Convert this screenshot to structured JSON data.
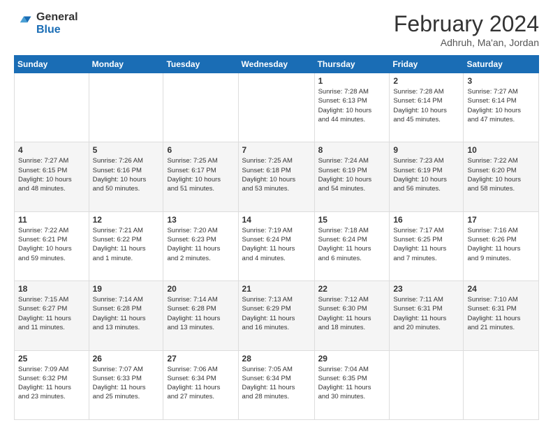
{
  "logo": {
    "general": "General",
    "blue": "Blue"
  },
  "title": "February 2024",
  "subtitle": "Adhruh, Ma'an, Jordan",
  "days_of_week": [
    "Sunday",
    "Monday",
    "Tuesday",
    "Wednesday",
    "Thursday",
    "Friday",
    "Saturday"
  ],
  "weeks": [
    [
      {
        "day": "",
        "info": ""
      },
      {
        "day": "",
        "info": ""
      },
      {
        "day": "",
        "info": ""
      },
      {
        "day": "",
        "info": ""
      },
      {
        "day": "1",
        "info": "Sunrise: 7:28 AM\nSunset: 6:13 PM\nDaylight: 10 hours\nand 44 minutes."
      },
      {
        "day": "2",
        "info": "Sunrise: 7:28 AM\nSunset: 6:14 PM\nDaylight: 10 hours\nand 45 minutes."
      },
      {
        "day": "3",
        "info": "Sunrise: 7:27 AM\nSunset: 6:14 PM\nDaylight: 10 hours\nand 47 minutes."
      }
    ],
    [
      {
        "day": "4",
        "info": "Sunrise: 7:27 AM\nSunset: 6:15 PM\nDaylight: 10 hours\nand 48 minutes."
      },
      {
        "day": "5",
        "info": "Sunrise: 7:26 AM\nSunset: 6:16 PM\nDaylight: 10 hours\nand 50 minutes."
      },
      {
        "day": "6",
        "info": "Sunrise: 7:25 AM\nSunset: 6:17 PM\nDaylight: 10 hours\nand 51 minutes."
      },
      {
        "day": "7",
        "info": "Sunrise: 7:25 AM\nSunset: 6:18 PM\nDaylight: 10 hours\nand 53 minutes."
      },
      {
        "day": "8",
        "info": "Sunrise: 7:24 AM\nSunset: 6:19 PM\nDaylight: 10 hours\nand 54 minutes."
      },
      {
        "day": "9",
        "info": "Sunrise: 7:23 AM\nSunset: 6:19 PM\nDaylight: 10 hours\nand 56 minutes."
      },
      {
        "day": "10",
        "info": "Sunrise: 7:22 AM\nSunset: 6:20 PM\nDaylight: 10 hours\nand 58 minutes."
      }
    ],
    [
      {
        "day": "11",
        "info": "Sunrise: 7:22 AM\nSunset: 6:21 PM\nDaylight: 10 hours\nand 59 minutes."
      },
      {
        "day": "12",
        "info": "Sunrise: 7:21 AM\nSunset: 6:22 PM\nDaylight: 11 hours\nand 1 minute."
      },
      {
        "day": "13",
        "info": "Sunrise: 7:20 AM\nSunset: 6:23 PM\nDaylight: 11 hours\nand 2 minutes."
      },
      {
        "day": "14",
        "info": "Sunrise: 7:19 AM\nSunset: 6:24 PM\nDaylight: 11 hours\nand 4 minutes."
      },
      {
        "day": "15",
        "info": "Sunrise: 7:18 AM\nSunset: 6:24 PM\nDaylight: 11 hours\nand 6 minutes."
      },
      {
        "day": "16",
        "info": "Sunrise: 7:17 AM\nSunset: 6:25 PM\nDaylight: 11 hours\nand 7 minutes."
      },
      {
        "day": "17",
        "info": "Sunrise: 7:16 AM\nSunset: 6:26 PM\nDaylight: 11 hours\nand 9 minutes."
      }
    ],
    [
      {
        "day": "18",
        "info": "Sunrise: 7:15 AM\nSunset: 6:27 PM\nDaylight: 11 hours\nand 11 minutes."
      },
      {
        "day": "19",
        "info": "Sunrise: 7:14 AM\nSunset: 6:28 PM\nDaylight: 11 hours\nand 13 minutes."
      },
      {
        "day": "20",
        "info": "Sunrise: 7:14 AM\nSunset: 6:28 PM\nDaylight: 11 hours\nand 13 minutes."
      },
      {
        "day": "21",
        "info": "Sunrise: 7:13 AM\nSunset: 6:29 PM\nDaylight: 11 hours\nand 16 minutes."
      },
      {
        "day": "22",
        "info": "Sunrise: 7:12 AM\nSunset: 6:30 PM\nDaylight: 11 hours\nand 18 minutes."
      },
      {
        "day": "23",
        "info": "Sunrise: 7:11 AM\nSunset: 6:31 PM\nDaylight: 11 hours\nand 20 minutes."
      },
      {
        "day": "24",
        "info": "Sunrise: 7:10 AM\nSunset: 6:31 PM\nDaylight: 11 hours\nand 21 minutes."
      }
    ],
    [
      {
        "day": "25",
        "info": "Sunrise: 7:09 AM\nSunset: 6:32 PM\nDaylight: 11 hours\nand 23 minutes."
      },
      {
        "day": "26",
        "info": "Sunrise: 7:07 AM\nSunset: 6:33 PM\nDaylight: 11 hours\nand 25 minutes."
      },
      {
        "day": "27",
        "info": "Sunrise: 7:06 AM\nSunset: 6:34 PM\nDaylight: 11 hours\nand 27 minutes."
      },
      {
        "day": "28",
        "info": "Sunrise: 7:05 AM\nSunset: 6:34 PM\nDaylight: 11 hours\nand 28 minutes."
      },
      {
        "day": "29",
        "info": "Sunrise: 7:04 AM\nSunset: 6:35 PM\nDaylight: 11 hours\nand 30 minutes."
      },
      {
        "day": "",
        "info": ""
      },
      {
        "day": "",
        "info": ""
      }
    ]
  ]
}
